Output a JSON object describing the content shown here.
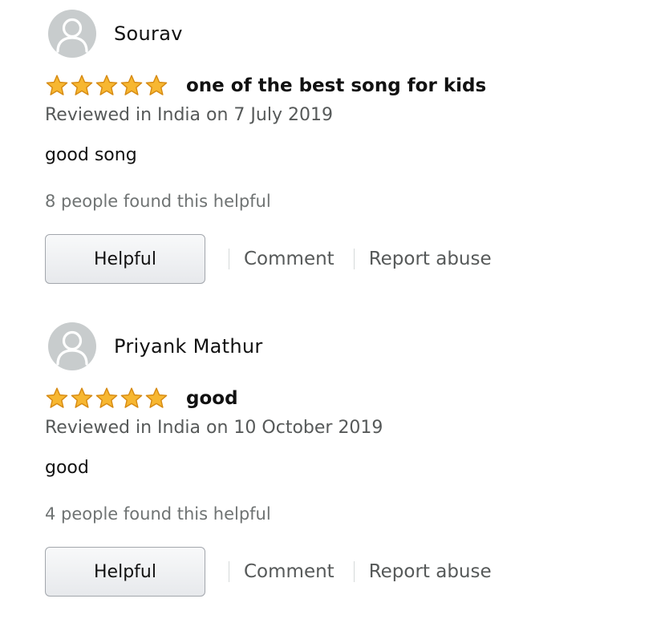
{
  "reviews": [
    {
      "reviewer": "Sourav",
      "rating": 5,
      "rating_max": 5,
      "title": "one of the best song for kids",
      "date": "Reviewed in India on 7 July 2019",
      "body": "good song",
      "helpful_count": "8 people found this helpful",
      "helpful_label": "Helpful",
      "comment_label": "Comment",
      "report_label": "Report abuse"
    },
    {
      "reviewer": "Priyank Mathur",
      "rating": 5,
      "rating_max": 5,
      "title": "good",
      "date": "Reviewed in India on 10 October 2019",
      "body": "good",
      "helpful_count": "4 people found this helpful",
      "helpful_label": "Helpful",
      "comment_label": "Comment",
      "report_label": "Report abuse"
    }
  ],
  "icons": {
    "avatar": "default-user-avatar-icon",
    "star": "star-filled-icon"
  },
  "colors": {
    "star_fill": "#f7b731",
    "star_stroke": "#d68a12",
    "avatar_bg": "#c8cccd",
    "secondary_text": "#565959"
  }
}
